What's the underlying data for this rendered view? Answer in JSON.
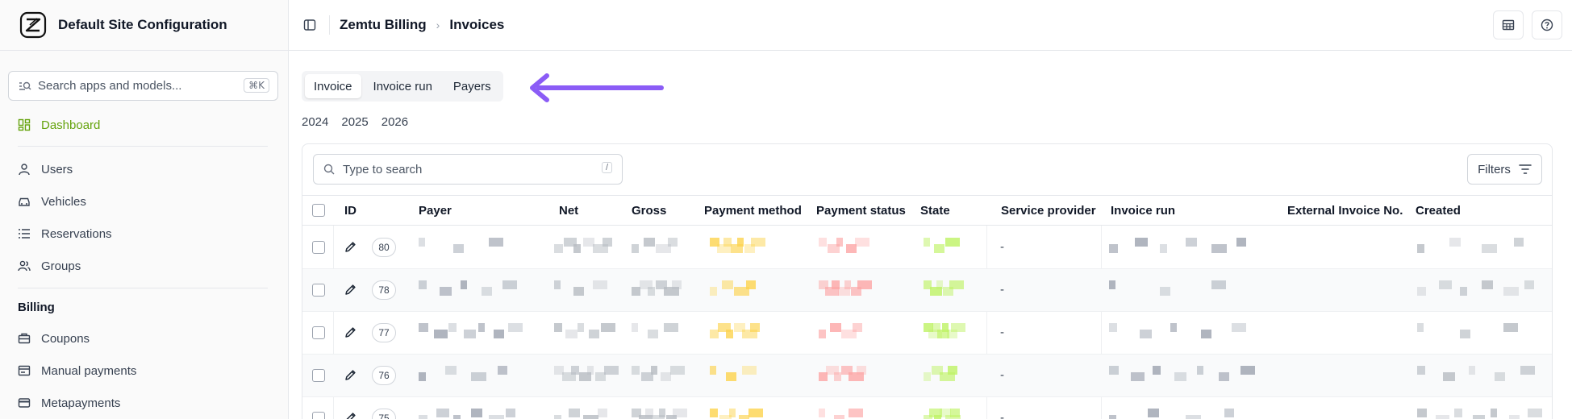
{
  "site": {
    "title": "Default Site Configuration"
  },
  "sidebar": {
    "search_placeholder": "Search apps and models...",
    "search_shortcut": "⌘K",
    "items": [
      {
        "label": "Dashboard",
        "icon": "dashboard-icon",
        "active": true
      },
      {
        "label": "Users",
        "icon": "user-icon"
      },
      {
        "label": "Vehicles",
        "icon": "car-icon"
      },
      {
        "label": "Reservations",
        "icon": "list-icon"
      },
      {
        "label": "Groups",
        "icon": "users-icon"
      }
    ],
    "billing_section": "Billing",
    "billing_items": [
      {
        "label": "Coupons",
        "icon": "ticket-icon"
      },
      {
        "label": "Manual payments",
        "icon": "receipt-icon"
      },
      {
        "label": "Metapayments",
        "icon": "card-icon"
      }
    ]
  },
  "breadcrumb": {
    "app": "Zemtu Billing",
    "separator": "›",
    "page": "Invoices"
  },
  "tabs": [
    "Invoice",
    "Invoice run",
    "Payers"
  ],
  "years": [
    "2024",
    "2025",
    "2026"
  ],
  "table": {
    "search_placeholder": "Type to search",
    "search_shortcut": "/",
    "filters_label": "Filters",
    "columns": [
      "ID",
      "Payer",
      "Net",
      "Gross",
      "Payment method",
      "Payment status",
      "State",
      "Service provider",
      "Invoice run",
      "External Invoice No.",
      "Created"
    ],
    "rows": [
      {
        "id": "80",
        "service_provider": "-"
      },
      {
        "id": "78",
        "service_provider": "-"
      },
      {
        "id": "77",
        "service_provider": "-"
      },
      {
        "id": "76",
        "service_provider": "-"
      },
      {
        "id": "75",
        "service_provider": "-"
      }
    ]
  },
  "colors": {
    "accent": "#65a30d",
    "arrow": "#8b5cf6"
  }
}
